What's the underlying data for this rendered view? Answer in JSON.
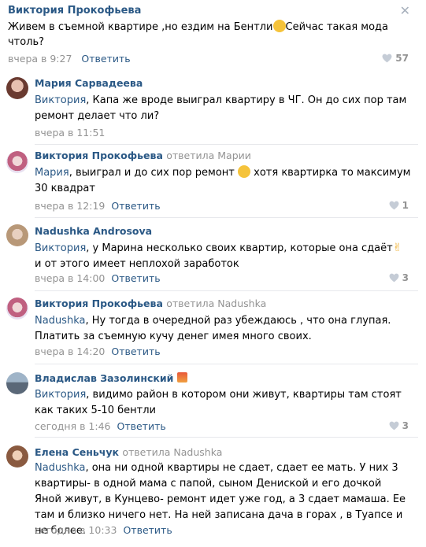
{
  "post": {
    "author": "Виктория Прокофьева",
    "text_before": "Живем в съемной квартире ,но ездим на Бентли",
    "text_after": "Сейчас такая мода чтоль?",
    "time": "вчера в 9:27",
    "reply": "Ответить",
    "likes": "57"
  },
  "comments": [
    {
      "author": "Мария Сарвадеева",
      "replied_to": "",
      "mention": "Виктория",
      "text": ", Капа же вроде выиграл квартиру в ЧГ. Он до сих пор там ремонт делает что ли?",
      "time": "вчера в 11:51",
      "reply": "",
      "likes": ""
    },
    {
      "author": "Виктория Прокофьева",
      "replied_to": "ответила Марии",
      "mention": "Мария",
      "text": ", выиграл и до сих пор ремонт",
      "text_after": "хотя квартирка то максимум 30 квадрат",
      "time": "вчера в 12:19",
      "reply": "Ответить",
      "likes": "1"
    },
    {
      "author": "Nadushka Androsova",
      "replied_to": "",
      "mention": "Виктория",
      "text": ", у Марина несколько своих квартир, которые она сдаёт",
      "text_after": "и от этого имеет неплохой заработок",
      "time": "вчера в 14:00",
      "reply": "Ответить",
      "likes": "3"
    },
    {
      "author": "Виктория Прокофьева",
      "replied_to": "ответила Nadushka",
      "mention": "Nadushka",
      "text": ", Ну тогда в очередной раз убеждаюсь , что она глупая. Платить за съемную кучу денег имея много своих.",
      "time": "вчера в 14:20",
      "reply": "Ответить",
      "likes": ""
    },
    {
      "author": "Владислав Зазолинский",
      "replied_to": "",
      "mention": "Виктория",
      "text": ", видимо район в котором они живут, квартиры там стоят как таких 5-10 бентли",
      "time": "сегодня в 1:46",
      "reply": "Ответить",
      "likes": "3"
    },
    {
      "author": "Елена Сеньчук",
      "replied_to": "ответила Nadushka",
      "mention": "Nadushka",
      "text": ", она ни одной квартиры не сдает, сдает ее мать. У них 3 квартиры- в одной мама с папой, сыном Дениской и его дочкой Яной живут, в Кунцево- ремонт идет уже год, а 3 сдает мамаша. Ее там и близко ничего нет. На ней записана дача в горах , в Туапсе и не более.",
      "time": "сегодня в 10:33",
      "reply": "Ответить",
      "likes": ""
    }
  ],
  "colors": {
    "link": "#2a5885",
    "meta": "#939393",
    "divider": "#e7e8ec"
  },
  "icons": {
    "close": "close-icon",
    "like": "heart-icon"
  }
}
